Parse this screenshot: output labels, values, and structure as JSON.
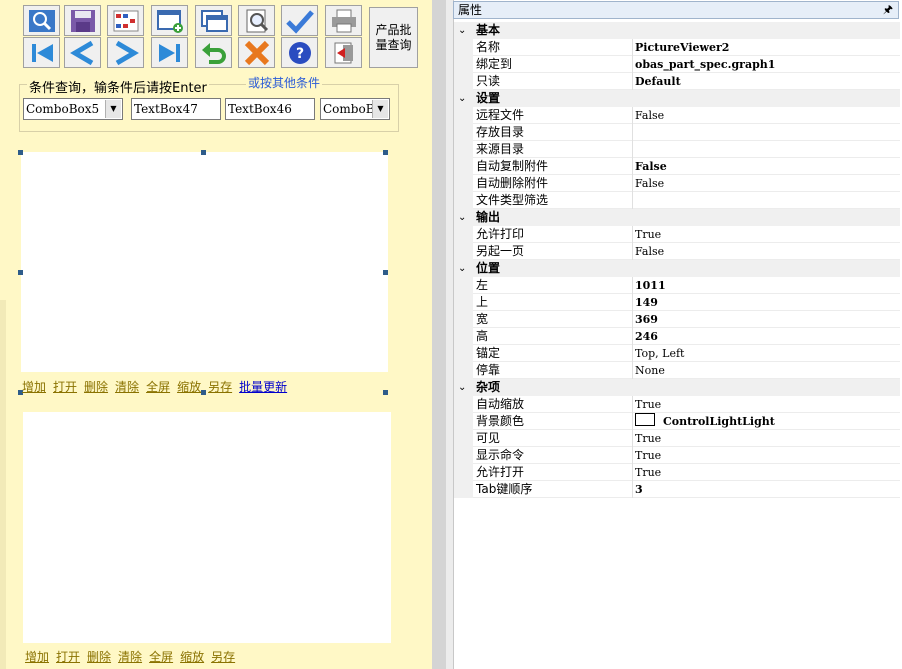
{
  "toolbar": {
    "row1_icons": [
      "search-icon",
      "save-icon",
      "grid-icon",
      "new-window-icon",
      "windows-icon",
      "preview-icon",
      "check-icon",
      "print-icon"
    ],
    "row2_icons": [
      "first-icon",
      "previous-icon",
      "next-icon",
      "last-icon",
      "undo-icon",
      "delete-icon",
      "help-icon",
      "exit-icon"
    ],
    "batch_query_label": "产品批量查询"
  },
  "query": {
    "title": "条件查询，输条件后请按Enter",
    "other_link": "或按其他条件",
    "fields": [
      "ComboBox5",
      "TextBox47",
      "TextBox46",
      "ComboBo"
    ]
  },
  "links1": [
    "增加",
    "打开",
    "删除",
    "清除",
    "全屏",
    "缩放",
    "另存",
    "批量更新"
  ],
  "links2": [
    "增加",
    "打开",
    "删除",
    "清除",
    "全屏",
    "缩放",
    "另存"
  ],
  "props": {
    "header": "属性",
    "categories": [
      {
        "name": "基本",
        "rows": [
          {
            "name": "名称",
            "value": "PictureViewer2",
            "bold": true
          },
          {
            "name": "绑定到",
            "value": "obas_part_spec.graph1",
            "bold": true
          },
          {
            "name": "只读",
            "value": "Default",
            "bold": true
          }
        ]
      },
      {
        "name": "设置",
        "rows": [
          {
            "name": "远程文件",
            "value": "False"
          },
          {
            "name": "存放目录",
            "value": ""
          },
          {
            "name": "来源目录",
            "value": ""
          },
          {
            "name": "自动复制附件",
            "value": "False",
            "bold": true
          },
          {
            "name": "自动删除附件",
            "value": "False"
          },
          {
            "name": "文件类型筛选",
            "value": ""
          }
        ]
      },
      {
        "name": "输出",
        "rows": [
          {
            "name": "允许打印",
            "value": "True"
          },
          {
            "name": "另起一页",
            "value": "False"
          }
        ]
      },
      {
        "name": "位置",
        "rows": [
          {
            "name": "左",
            "value": "1011",
            "bold": true
          },
          {
            "name": "上",
            "value": "149",
            "bold": true
          },
          {
            "name": "宽",
            "value": "369",
            "bold": true
          },
          {
            "name": "高",
            "value": "246",
            "bold": true
          },
          {
            "name": "锚定",
            "value": "Top, Left"
          },
          {
            "name": "停靠",
            "value": "None"
          }
        ]
      },
      {
        "name": "杂项",
        "rows": [
          {
            "name": "自动缩放",
            "value": "True"
          },
          {
            "name": "背景颜色",
            "value": "ControlLightLight",
            "bold": true,
            "swatch": "#ffffff"
          },
          {
            "name": "可见",
            "value": "True"
          },
          {
            "name": "显示命令",
            "value": "True"
          },
          {
            "name": "允许打开",
            "value": "True"
          },
          {
            "name": "Tab键顺序",
            "value": "3",
            "bold": true
          }
        ]
      }
    ]
  },
  "colors": {
    "panel_bg": "#fff8c6",
    "accent_blue": "#2e5c8a",
    "link": "#8a7200"
  }
}
